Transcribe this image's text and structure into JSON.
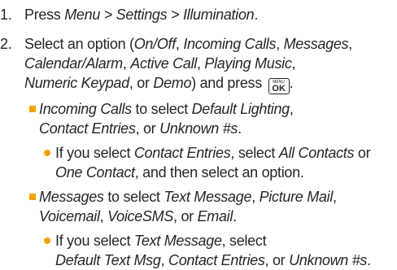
{
  "accent_color": "#f2a300",
  "steps": [
    {
      "number": "1.",
      "t": [
        "Press ",
        "Menu",
        " > ",
        "Settings",
        " > ",
        "Illumination",
        "."
      ]
    },
    {
      "number": "2.",
      "t": [
        "Select an option (",
        "On/Off",
        ", ",
        "Incoming Calls",
        ", ",
        "Messages",
        ",",
        "Calendar/Alarm",
        ", ",
        "Active Call",
        ", ",
        "Playing Music",
        ",",
        "Numeric Keypad",
        ", or ",
        "Demo",
        ") and press ",
        "."
      ],
      "key": {
        "top": "MENU",
        "bottom": "OK",
        "icon": "menu-ok-key-icon"
      }
    }
  ],
  "bullets": [
    {
      "t": [
        "Incoming Calls",
        " to select ",
        "Default Lighting",
        ",",
        "Contact Entries",
        ", or ",
        "Unknown #s",
        "."
      ],
      "sub": {
        "t": [
          "If you select ",
          "Contact Entries",
          ", select ",
          "All Contacts",
          " or",
          "One Contact",
          ", and then select an option."
        ]
      }
    },
    {
      "t": [
        "Messages",
        " to select ",
        "Text Message",
        ", ",
        "Picture Mail",
        ",",
        "Voicemail",
        ", ",
        "VoiceSMS",
        ", or ",
        "Email",
        "."
      ],
      "sub": {
        "t": [
          "If you select ",
          "Text Message",
          ", select",
          "Default Text Msg",
          ", ",
          "Contact Entries",
          ", or ",
          "Unknown #s",
          "."
        ]
      }
    }
  ]
}
